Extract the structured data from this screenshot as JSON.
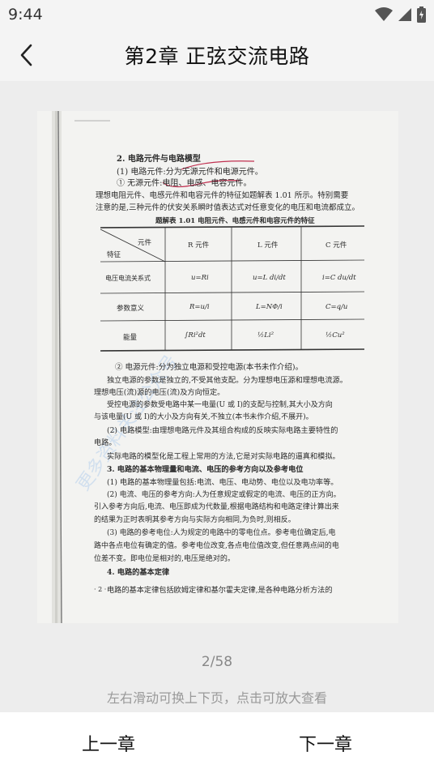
{
  "status": {
    "time": "9:44"
  },
  "header": {
    "title": "第2章 正弦交流电路"
  },
  "document": {
    "heading": "2. 电路元件与电路模型",
    "line1": "(1) 电路元件:分为无源元件和电源元件。",
    "line2": "① 无源元件:电阻、电感、电容元件。",
    "line3": "理想电阻元件、电感元件和电容元件的特征如题解表 1.01 所示。特别需要",
    "line4": "注意的是,三种元件的伏安关系瞬时值表达式对任意变化的电压和电流都成立。",
    "table_caption": "题解表 1.01  电阻元件、电感元件和电容元件的特征",
    "table_header_element": "元件",
    "table_header_feature": "特征",
    "table_col_r": "R 元件",
    "table_col_l": "L 元件",
    "table_col_c": "C 元件",
    "row1_label": "电压电流关系式",
    "row1_r": "u=Ri",
    "row1_l": "u=L di/dt",
    "row1_c": "i=C du/dt",
    "row2_label": "参数意义",
    "row2_r": "R=u/i",
    "row2_l": "L=NΦ/i",
    "row2_c": "C=q/u",
    "row3_label": "能量",
    "row3_r": "∫Ri²dt",
    "row3_l": "½Li²",
    "row3_c": "½Cu²",
    "p1": "② 电源元件:分为独立电源和受控电源(本书未作介绍)。",
    "p2": "独立电源的参数是独立的,不受其他支配。分为理想电压源和理想电流源。",
    "p3": "理想电压(流)源的电压(流)及方向恒定。",
    "p4": "受控电源的参数受电路中某一电量(U 或 I)的支配与控制,其大小及方向",
    "p5": "与该电量(U 或 I)的大小及方向有关,不独立(本书未作介绍,不展开)。",
    "p6": "(2) 电路模型:由理想电路元件及其组合构成的反映实际电路主要特性的",
    "p7": "电路。",
    "p8": "实际电路的模型化是工程上常用的方法,它是对实际电路的逼真和模拟。",
    "p9": "3. 电路的基本物理量和电流、电压的参考方向以及参考电位",
    "p10": "(1) 电路的基本物理量包括:电流、电压、电动势、电位以及电功率等。",
    "p11": "(2) 电流、电压的参考方向:人为任意规定或假定的电流、电压的正方向。",
    "p12": "引入参考方向后,电流、电压即成为代数量,根据电路结构和电路定律计算出来",
    "p13": "的结果为正时表明其参考方向与实际方向相同,为负时,则相反。",
    "p14": "(3) 电路的参考电位:人为规定的电路中的零电位点。参考电位确定后,电",
    "p15": "路中各点电位有确定的值。参考电位改变,各点电位值改变,但任意两点间的电",
    "p16": "位差不变。即电位是相对的,电压是绝对的。",
    "p17": "4. 电路的基本定律",
    "p18": "电路的基本定律包括欧姆定律和基尔霍夫定律,是各种电路分析方法的",
    "page_num": "· 2 ·"
  },
  "pager": {
    "indicator": "2/58",
    "hint": "左右滑动可换上下页，点击可放大查看"
  },
  "nav": {
    "prev": "上一章",
    "next": "下一章"
  }
}
